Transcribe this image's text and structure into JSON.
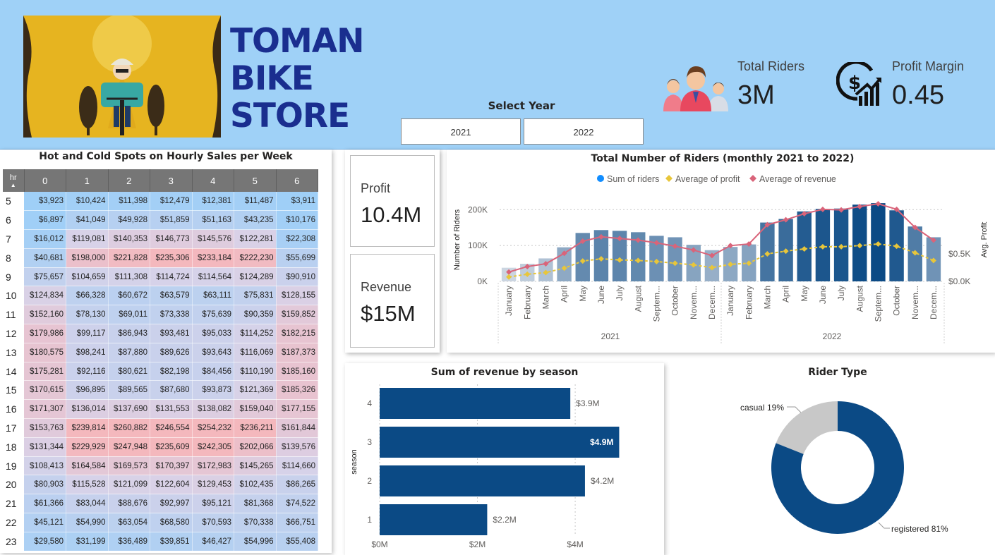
{
  "header": {
    "brand_line1": "TOMAN",
    "brand_line2": "BIKE",
    "brand_line3": "STORE",
    "select_year_label": "Select Year",
    "years": [
      "2021",
      "2022"
    ],
    "kpi_riders_label": "Total Riders",
    "kpi_riders_value": "3M",
    "kpi_margin_label": "Profit Margin",
    "kpi_margin_value": "0.45"
  },
  "colors": {
    "header_bg": "#9fd1f7",
    "brand": "#1a2e8f",
    "bar_dark": "#0b4a85",
    "profit_line": "#e8c63a",
    "revenue_line": "#d9647a",
    "riders_dot": "#118dff",
    "donut_registered": "#0b4a85",
    "donut_casual": "#c8c8c8",
    "heat_cold": "#9fcff7",
    "heat_hot": "#f4b8bd"
  },
  "icons": {
    "riders": "people-group-icon",
    "margin": "dollar-growth-icon"
  },
  "heatmap": {
    "title": "Hot and Cold Spots on Hourly Sales per Week",
    "hr_header": "hr",
    "columns": [
      "0",
      "1",
      "2",
      "3",
      "4",
      "5",
      "6"
    ],
    "rows": [
      {
        "hr": "5",
        "cells": [
          "$3,923",
          "$10,424",
          "$11,398",
          "$12,479",
          "$12,381",
          "$11,487",
          "$3,911"
        ]
      },
      {
        "hr": "6",
        "cells": [
          "$6,897",
          "$41,049",
          "$49,928",
          "$51,859",
          "$51,163",
          "$43,235",
          "$10,176"
        ]
      },
      {
        "hr": "7",
        "cells": [
          "$16,012",
          "$119,081",
          "$140,353",
          "$146,773",
          "$145,576",
          "$122,281",
          "$22,308"
        ]
      },
      {
        "hr": "8",
        "cells": [
          "$40,681",
          "$198,000",
          "$221,828",
          "$235,306",
          "$233,184",
          "$222,230",
          "$55,699"
        ]
      },
      {
        "hr": "9",
        "cells": [
          "$75,657",
          "$104,659",
          "$111,308",
          "$114,724",
          "$114,564",
          "$124,289",
          "$90,910"
        ]
      },
      {
        "hr": "10",
        "cells": [
          "$124,834",
          "$66,328",
          "$60,672",
          "$63,579",
          "$63,111",
          "$75,831",
          "$128,155"
        ]
      },
      {
        "hr": "11",
        "cells": [
          "$152,160",
          "$78,130",
          "$69,011",
          "$73,338",
          "$75,639",
          "$90,359",
          "$159,852"
        ]
      },
      {
        "hr": "12",
        "cells": [
          "$179,986",
          "$99,117",
          "$86,943",
          "$93,481",
          "$95,033",
          "$114,252",
          "$182,215"
        ]
      },
      {
        "hr": "13",
        "cells": [
          "$180,575",
          "$98,241",
          "$87,880",
          "$89,626",
          "$93,643",
          "$116,069",
          "$187,373"
        ]
      },
      {
        "hr": "14",
        "cells": [
          "$175,281",
          "$92,116",
          "$80,621",
          "$82,198",
          "$84,456",
          "$110,190",
          "$185,160"
        ]
      },
      {
        "hr": "15",
        "cells": [
          "$170,615",
          "$96,895",
          "$89,565",
          "$87,680",
          "$93,873",
          "$121,369",
          "$185,326"
        ]
      },
      {
        "hr": "16",
        "cells": [
          "$171,307",
          "$136,014",
          "$137,690",
          "$131,553",
          "$138,082",
          "$159,040",
          "$177,155"
        ]
      },
      {
        "hr": "17",
        "cells": [
          "$153,763",
          "$239,814",
          "$260,882",
          "$246,554",
          "$254,232",
          "$236,211",
          "$161,844"
        ]
      },
      {
        "hr": "18",
        "cells": [
          "$131,344",
          "$229,929",
          "$247,948",
          "$235,609",
          "$242,305",
          "$202,066",
          "$139,576"
        ]
      },
      {
        "hr": "19",
        "cells": [
          "$108,413",
          "$164,584",
          "$169,573",
          "$170,397",
          "$172,983",
          "$145,265",
          "$114,660"
        ]
      },
      {
        "hr": "20",
        "cells": [
          "$80,903",
          "$115,528",
          "$121,099",
          "$122,604",
          "$129,453",
          "$102,435",
          "$86,265"
        ]
      },
      {
        "hr": "21",
        "cells": [
          "$61,366",
          "$83,044",
          "$88,676",
          "$92,997",
          "$95,121",
          "$81,368",
          "$74,522"
        ]
      },
      {
        "hr": "22",
        "cells": [
          "$45,121",
          "$54,990",
          "$63,054",
          "$68,580",
          "$70,593",
          "$70,338",
          "$66,751"
        ]
      },
      {
        "hr": "23",
        "cells": [
          "$29,580",
          "$31,199",
          "$36,489",
          "$39,851",
          "$46,427",
          "$54,996",
          "$55,408"
        ]
      }
    ]
  },
  "cards": {
    "profit_label": "Profit",
    "profit_value": "10.4M",
    "revenue_label": "Revenue",
    "revenue_value": "$15M"
  },
  "chart_data": [
    {
      "type": "bar",
      "title": "Total Number of Riders (monthly 2021 to 2022)",
      "legend": [
        "Sum of riders",
        "Average of profit",
        "Average of revenue"
      ],
      "legend_position": "top-center",
      "ylabel": "Number of Riders",
      "y2label": "Avg. Profit",
      "ylim": [
        0,
        230000
      ],
      "y_ticks": [
        "0K",
        "100K",
        "200K"
      ],
      "y2_ticks": [
        "$0.0K",
        "$0.5K"
      ],
      "years": [
        "2021",
        "2022"
      ],
      "categories": [
        "January",
        "February",
        "March",
        "April",
        "May",
        "June",
        "July",
        "August",
        "Septem...",
        "October",
        "Novem...",
        "Decem...",
        "January",
        "February",
        "March",
        "April",
        "May",
        "June",
        "July",
        "August",
        "Septem...",
        "October",
        "Novem...",
        "Decem..."
      ],
      "series": [
        {
          "name": "Sum of riders",
          "values": [
            38000,
            49000,
            64000,
            95000,
            135000,
            143000,
            141000,
            137000,
            127000,
            123000,
            102000,
            87000,
            96000,
            103000,
            164000,
            174000,
            195000,
            202000,
            203000,
            214000,
            218000,
            198000,
            153000,
            123000
          ]
        },
        {
          "name": "Average of profit",
          "values": [
            0.08,
            0.13,
            0.16,
            0.24,
            0.37,
            0.41,
            0.39,
            0.38,
            0.36,
            0.33,
            0.3,
            0.25,
            0.31,
            0.33,
            0.5,
            0.55,
            0.59,
            0.63,
            0.63,
            0.65,
            0.68,
            0.64,
            0.52,
            0.38
          ]
        },
        {
          "name": "Average of revenue",
          "values": [
            0.17,
            0.27,
            0.32,
            0.51,
            0.73,
            0.81,
            0.78,
            0.75,
            0.7,
            0.64,
            0.57,
            0.47,
            0.65,
            0.68,
            1.03,
            1.12,
            1.23,
            1.31,
            1.3,
            1.36,
            1.41,
            1.31,
            0.98,
            0.75
          ]
        }
      ]
    },
    {
      "type": "bar",
      "title": "Sum of revenue by season",
      "ylabel": "season",
      "categories": [
        "4",
        "3",
        "2",
        "1"
      ],
      "values": [
        3.9,
        4.9,
        4.2,
        2.2
      ],
      "value_labels": [
        "$3.9M",
        "$4.9M",
        "$4.2M",
        "$2.2M"
      ],
      "x_ticks": [
        "$0M",
        "$2M",
        "$4M"
      ],
      "xlim": [
        0,
        5.5
      ]
    },
    {
      "type": "pie",
      "title": "Rider Type",
      "categories": [
        "casual",
        "registered"
      ],
      "values": [
        19,
        81
      ],
      "value_labels": [
        "casual 19%",
        "registered 81%"
      ]
    }
  ]
}
